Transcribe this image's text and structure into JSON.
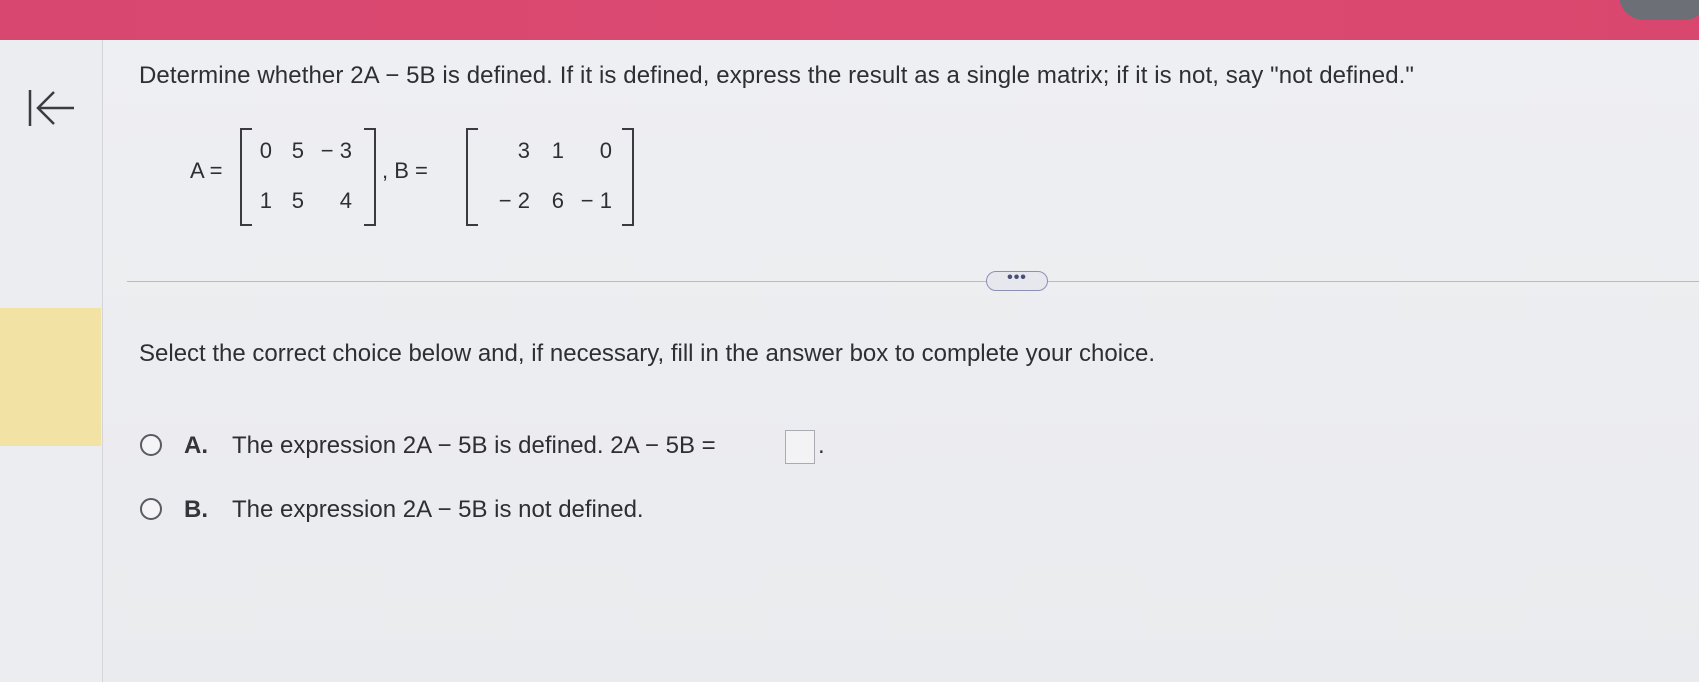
{
  "colors": {
    "topbar": "#d8476f",
    "background": "#ebecef",
    "highlight": "#f2e3a4",
    "more_button_border": "#8d90b4"
  },
  "nav": {
    "back_icon": "collapse-left-arrow-icon"
  },
  "question": {
    "prompt": "Determine whether 2A − 5B is defined. If it is defined, express the result as a single matrix; if it is not, say \"not defined.\"",
    "matrix_a_label": "A =",
    "matrix_b_label": ", B =",
    "matrix_a": [
      [
        "0",
        "5",
        "− 3"
      ],
      [
        "1",
        "5",
        "4"
      ]
    ],
    "matrix_b": [
      [
        "3",
        "1",
        "0"
      ],
      [
        "− 2",
        "6",
        "− 1"
      ]
    ]
  },
  "more_button": {
    "label": "•••"
  },
  "instructions": "Select the correct choice below and, if necessary, fill in the answer box to complete your choice.",
  "choices": [
    {
      "letter": "A.",
      "text": "The expression 2A − 5B is defined. 2A − 5B =",
      "answer_value": "",
      "suffix": "."
    },
    {
      "letter": "B.",
      "text": "The expression 2A − 5B is not defined."
    }
  ]
}
